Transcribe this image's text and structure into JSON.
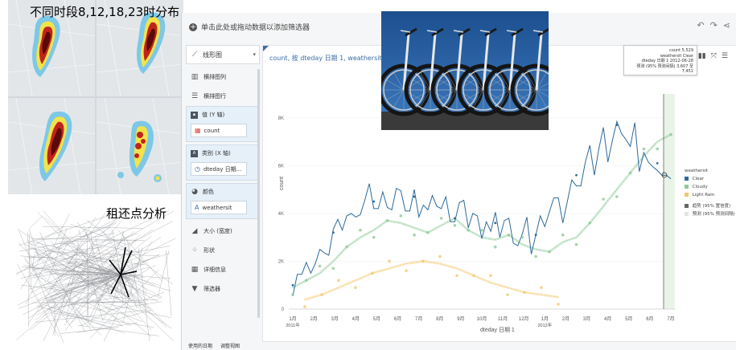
{
  "captions": {
    "heatmap": "不同时段8,12,18,23时分布",
    "network": "租还点分析"
  },
  "toolbar": {
    "add_filter": "单击此处或拖动数据以添加筛选器",
    "undo_icon": "undo-icon",
    "redo_icon": "redo-icon",
    "share_icon": "share-icon"
  },
  "viz_type": {
    "label": "线形图"
  },
  "shelves": {
    "columns": "横排图列",
    "rows": "横排图行",
    "value_header": "值 (Y 轴)",
    "value_pill": "count",
    "category_header": "类别 (X 轴)",
    "category_pill": "dteday 日期...",
    "color_header": "颜色",
    "color_pill": "weathersit",
    "size": "大小 (宽度)",
    "shape": "形状",
    "detail": "详细信息",
    "filter": "筛选器"
  },
  "chart": {
    "title": "count, 按 dteday 日期 1, weathersit"
  },
  "tooltip": {
    "line1": "count  5,529",
    "line2": "weathersit  Clear",
    "line3": "dteday 日期 1  2012-06-28",
    "line4": "预测 (95% 预测间隔)  3,607 至 7,451"
  },
  "legend": {
    "title": "weathersit",
    "items": [
      {
        "label": "Clear",
        "color": "#2c6a9b"
      },
      {
        "label": "Cloudy",
        "color": "#8fc99a"
      },
      {
        "label": "Light Rain",
        "color": "#f2c86e"
      }
    ],
    "trend": "趋势 (95% 置信度)",
    "forecast": "预测 (95% 预测间隔)"
  },
  "bottom": {
    "tab1": "使用的日期",
    "tab2": "调整视图"
  },
  "chart_data": {
    "type": "line",
    "xlabel": "dteday 日期 1",
    "ylabel": "count",
    "ylim": [
      0,
      9000
    ],
    "y_ticks": [
      "0",
      "2K",
      "4K",
      "6K",
      "8K"
    ],
    "x_ticks": [
      "1月",
      "2月",
      "3月",
      "4月",
      "5月",
      "6月",
      "7月",
      "8月",
      "9月",
      "10月",
      "11月",
      "12月",
      "1月",
      "2月",
      "3月",
      "4月",
      "5月",
      "6月",
      "7月"
    ],
    "x_year_labels": [
      "2011年",
      "2012年"
    ],
    "series": [
      {
        "name": "Clear",
        "color": "#2c6a9b",
        "values": [
          1000,
          1600,
          1300,
          1500,
          1800,
          1900,
          2200,
          2800,
          2400,
          3200,
          3300,
          3600,
          3900,
          3700,
          4300,
          4100,
          4400,
          4800,
          4500,
          4200,
          4600,
          4700,
          4300,
          4900,
          4500,
          4400,
          4100,
          4700,
          4300,
          4500,
          4000,
          4300,
          4600,
          4200,
          4400,
          4100,
          3800,
          4300,
          4100,
          3700,
          4000,
          3600,
          3400,
          3800,
          3100,
          3600,
          3300,
          3700,
          3500,
          3200,
          2800,
          3000,
          3400,
          2600,
          3100,
          3600,
          3900,
          4200,
          4500,
          4200,
          3900,
          4500,
          5100,
          5600,
          5300,
          6000,
          6400,
          5900,
          6700,
          7300,
          6600,
          7200,
          7700,
          6900,
          7400,
          6800,
          7500,
          6200,
          6700,
          6000,
          5500,
          6100,
          5600,
          5300,
          5900
        ]
      },
      {
        "name": "Cloudy",
        "color": "#8fc99a",
        "values": [
          900,
          1200,
          1500,
          2000,
          2600,
          3000,
          3300,
          3700,
          3600,
          3400,
          3200,
          3500,
          3800,
          3300,
          3000,
          2900,
          3100,
          2700,
          2500,
          2400,
          2800,
          3000,
          3600,
          4300,
          5000,
          5700,
          6400,
          7000,
          7300
        ]
      },
      {
        "name": "Light Rain",
        "color": "#f2c86e",
        "values": [
          400,
          600,
          900,
          1200,
          1500,
          1700,
          1900,
          2000,
          1900,
          1700,
          1400,
          1100,
          900,
          700,
          600,
          500
        ]
      }
    ]
  }
}
